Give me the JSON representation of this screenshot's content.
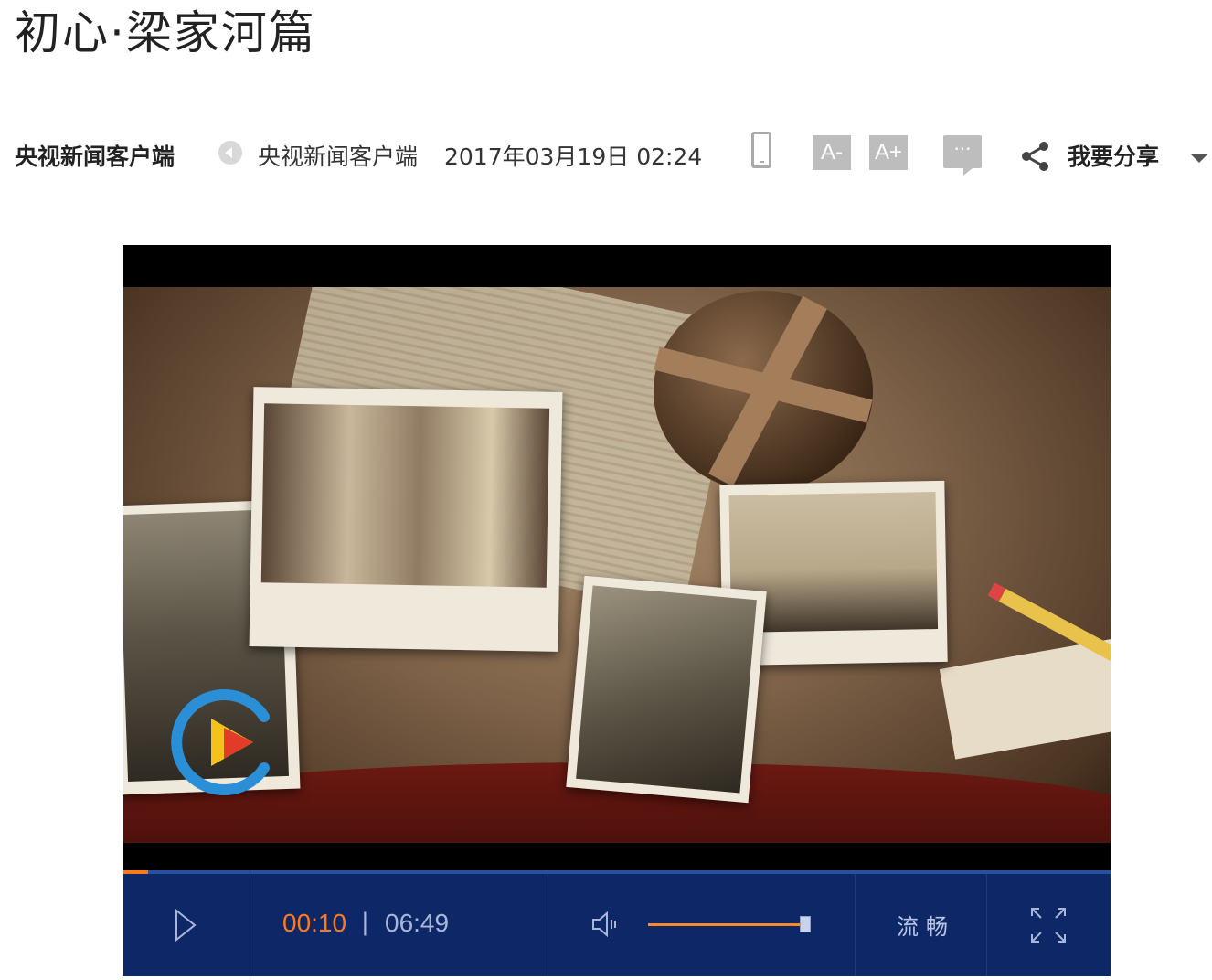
{
  "article": {
    "title": "初心·梁家河篇",
    "source_strong": "央视新闻客户端",
    "source": "央视新闻客户端",
    "date": "2017年03月19日 02:24"
  },
  "toolbar": {
    "font_smaller": "A-",
    "font_larger": "A+",
    "comment": "···",
    "share_label": "我要分享"
  },
  "player": {
    "progress_fraction": 0.025,
    "current_time": "00:10",
    "separator": "|",
    "total_time": "06:49",
    "volume_fraction": 0.98,
    "quality": "流畅"
  },
  "colors": {
    "accent": "#ff7a1a",
    "controls_bg": "#0e2766",
    "progress_track": "#2a4f9e"
  },
  "icons": {
    "back": "back-circle-icon",
    "mobile": "mobile-phone-icon",
    "share": "share-icon",
    "play": "play-icon",
    "volume": "volume-icon",
    "fullscreen": "fullscreen-icon",
    "logo": "cctv-logo-icon"
  }
}
